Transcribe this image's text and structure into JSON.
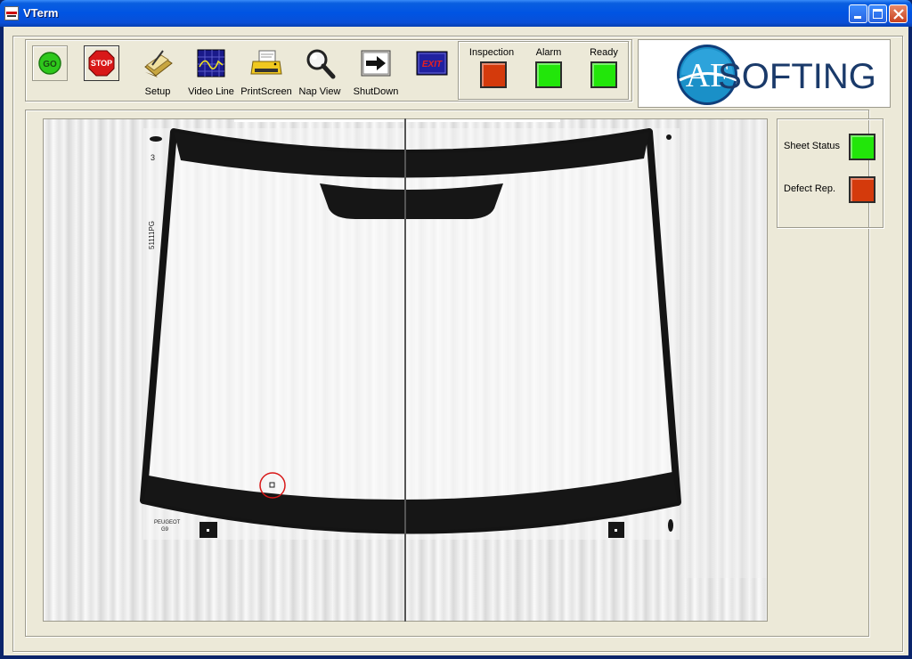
{
  "window": {
    "title": "VTerm"
  },
  "titlebar_buttons": [
    {
      "name": "minimize-icon"
    },
    {
      "name": "maximize-icon"
    },
    {
      "name": "close-icon"
    }
  ],
  "toolbar": {
    "go_label": "GO",
    "stop_label": "STOP",
    "setup_label": "Setup",
    "videoline_label": "Video Line",
    "printscreen_label": "PrintScreen",
    "napview_label": "Nap View",
    "shutdown_label": "ShutDown",
    "exit_label": "EXIT"
  },
  "status": {
    "inspection_label": "Inspection",
    "alarm_label": "Alarm",
    "ready_label": "Ready",
    "inspection_state": "red",
    "alarm_state": "green",
    "ready_state": "green"
  },
  "logo": {
    "mark": "AF",
    "text": "SOFTING"
  },
  "side_panel": {
    "sheet_status_label": "Sheet Status",
    "sheet_status_state": "green",
    "defect_rep_label": "Defect Rep.",
    "defect_rep_state": "red"
  },
  "scan": {
    "left_code": "51111PG",
    "mark_number": "3",
    "brand_line1": "PEUGEOT",
    "brand_line2": "G9"
  },
  "colors": {
    "accent_red": "#d43a0c",
    "accent_green": "#22e60a",
    "title_blue": "#0054e3"
  }
}
